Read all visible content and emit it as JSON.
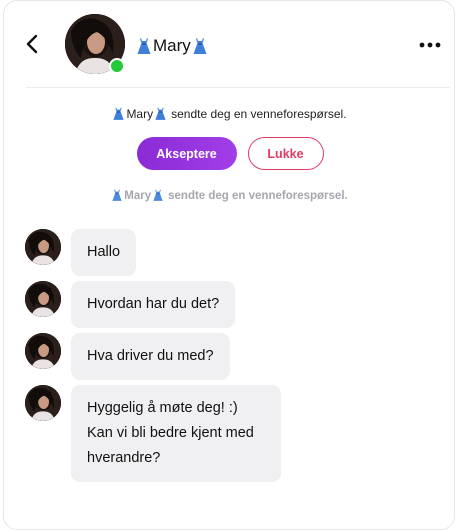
{
  "header": {
    "contact_name": "Mary",
    "back_icon": "back-arrow-icon",
    "more_icon": "more-dots-icon",
    "online_status_color": "#22c938"
  },
  "friend_request": {
    "name": "Mary",
    "text": "sendte deg en venneforespørsel.",
    "accept_label": "Akseptere",
    "close_label": "Lukke",
    "accept_color": "#8a2bd6",
    "close_color": "#e23a67"
  },
  "friend_request_repeat": {
    "name": "Mary",
    "text": "sendte deg en venneforespørsel."
  },
  "messages": [
    {
      "text": "Hallo"
    },
    {
      "text": "Hvordan har du det?"
    },
    {
      "text": "Hva driver du med?"
    },
    {
      "text": "Hyggelig å møte deg! :) Kan vi bli bedre kjent med hverandre?"
    }
  ]
}
